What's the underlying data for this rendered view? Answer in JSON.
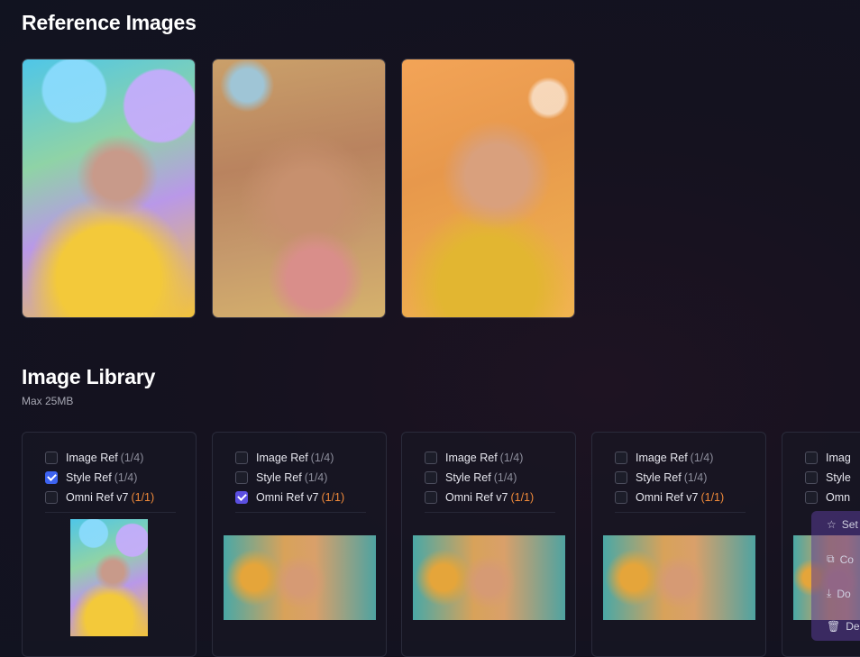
{
  "reference": {
    "title": "Reference Images",
    "images": [
      {
        "icon": "bubbles-portrait-image"
      },
      {
        "icon": "closeup-face-image"
      },
      {
        "icon": "glitter-portrait-image"
      }
    ]
  },
  "library": {
    "title": "Image Library",
    "subtitle": "Max 25MB",
    "labels": {
      "image_ref": "Image Ref",
      "style_ref": "Style Ref",
      "omni_ref": "Omni Ref v7"
    },
    "counts": {
      "image_ref": "(1/4)",
      "style_ref": "(1/4)",
      "omni_ref": "(1/1)"
    },
    "cards": [
      {
        "image_ref": false,
        "style_ref": true,
        "omni_ref": false
      },
      {
        "image_ref": false,
        "style_ref": false,
        "omni_ref": true
      },
      {
        "image_ref": false,
        "style_ref": false,
        "omni_ref": false
      },
      {
        "image_ref": false,
        "style_ref": false,
        "omni_ref": false
      },
      {
        "image_ref": false,
        "style_ref": false,
        "omni_ref": false
      }
    ],
    "partial_labels": {
      "image_ref": "Imag",
      "style_ref": "Style",
      "omni_ref": "Omn"
    }
  },
  "context_menu": {
    "items": [
      "Set",
      "Co",
      "Do",
      "Del"
    ]
  },
  "colors": {
    "checkbox_blue": "#3d63f0",
    "checkbox_purple": "#5b4fe0",
    "count_orange": "#f08a3a"
  }
}
